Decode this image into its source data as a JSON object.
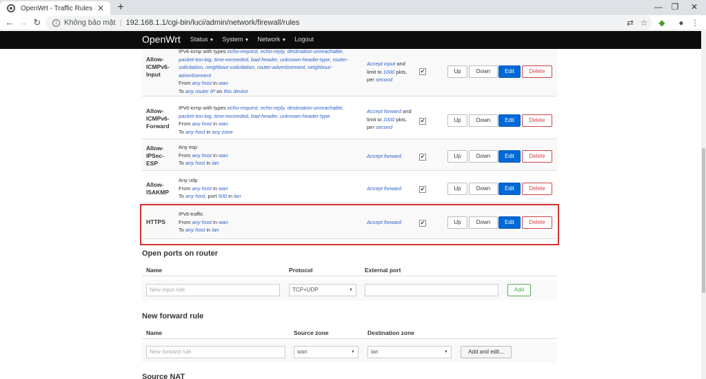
{
  "browser": {
    "tab_title": "OpenWrt - Traffic Rules - LuCI",
    "tab_close": "✕",
    "new_tab": "+",
    "win_min": "—",
    "win_restore": "❐",
    "win_close": "✕",
    "security": "Không bảo mật",
    "url": "192.168.1.1/cgi-bin/luci/admin/network/firewall/rules"
  },
  "header": {
    "brand": "OpenWrt",
    "menu": [
      "Status",
      "System",
      "Network",
      "Logout"
    ]
  },
  "rules": [
    {
      "name": [
        "Allow-",
        "ICMPv6-",
        "Input"
      ],
      "desc_top": "IPv6-icmp with types",
      "desc_types": "echo-request, echo-reply, destination-unreachable, packet-too-big, time-exceeded, bad-header, unknown-header-type, router-solicitation, neighbour-solicitation, router-advertisement, neighbour-advertisement",
      "from_a": "any host",
      "from_b": "wan",
      "to_a": "any router IP",
      "to_mid": "on",
      "to_b": "this device",
      "act_a": "Accept input",
      "act_b": "and limit to",
      "act_c": "1000",
      "act_d": "pkts. per",
      "act_e": "second"
    },
    {
      "name": [
        "Allow-",
        "ICMPv6-",
        "Forward"
      ],
      "desc_top": "IPv6-icmp with types",
      "desc_types": "echo-request, echo-reply, destination-unreachable, packet-too-big, time-exceeded, bad-header, unknown-header-type",
      "from_a": "any host",
      "from_b": "wan",
      "to_a": "any host",
      "to_b": "any zone",
      "act_a": "Accept forward",
      "act_b": "and limit to",
      "act_c": "1000",
      "act_d": "pkts. per",
      "act_e": "second"
    },
    {
      "name": [
        "Allow-",
        "IPSec-",
        "ESP"
      ],
      "desc_top": "Any esp",
      "from_a": "any host",
      "from_b": "wan",
      "to_a": "any host",
      "to_b": "lan",
      "act_a": "Accept forward"
    },
    {
      "name": [
        "Allow-",
        "ISAKMP"
      ],
      "desc_top": "Any udp",
      "from_a": "any host",
      "from_b": "wan",
      "to_a": "any host",
      "to_port": "500",
      "to_b": "lan",
      "act_a": "Accept forward"
    },
    {
      "name": [
        "HTTPS"
      ],
      "desc_top": "IPv6-traffic",
      "from_a": "any host",
      "from_b": "wan",
      "to_a": "any host",
      "to_b": "lan",
      "act_a": "Accept forward"
    }
  ],
  "labels": {
    "from": "From",
    "in": "in",
    "to": "To",
    "port": ", port",
    "up": "Up",
    "down": "Down",
    "edit": "Edit",
    "delete": "Delete",
    "check": "✔"
  },
  "open_ports": {
    "title": "Open ports on router",
    "col_name": "Name",
    "col_protocol": "Protocol",
    "col_port": "External port",
    "name_placeholder": "New input rule",
    "protocol": "TCP+UDP",
    "add": "Add"
  },
  "forward": {
    "title": "New forward rule",
    "col_name": "Name",
    "col_src": "Source zone",
    "col_dst": "Destination zone",
    "name_placeholder": "New forward rule",
    "src": "wan",
    "dst": "lan",
    "add_edit": "Add and edit..."
  },
  "next_section": "Source NAT"
}
